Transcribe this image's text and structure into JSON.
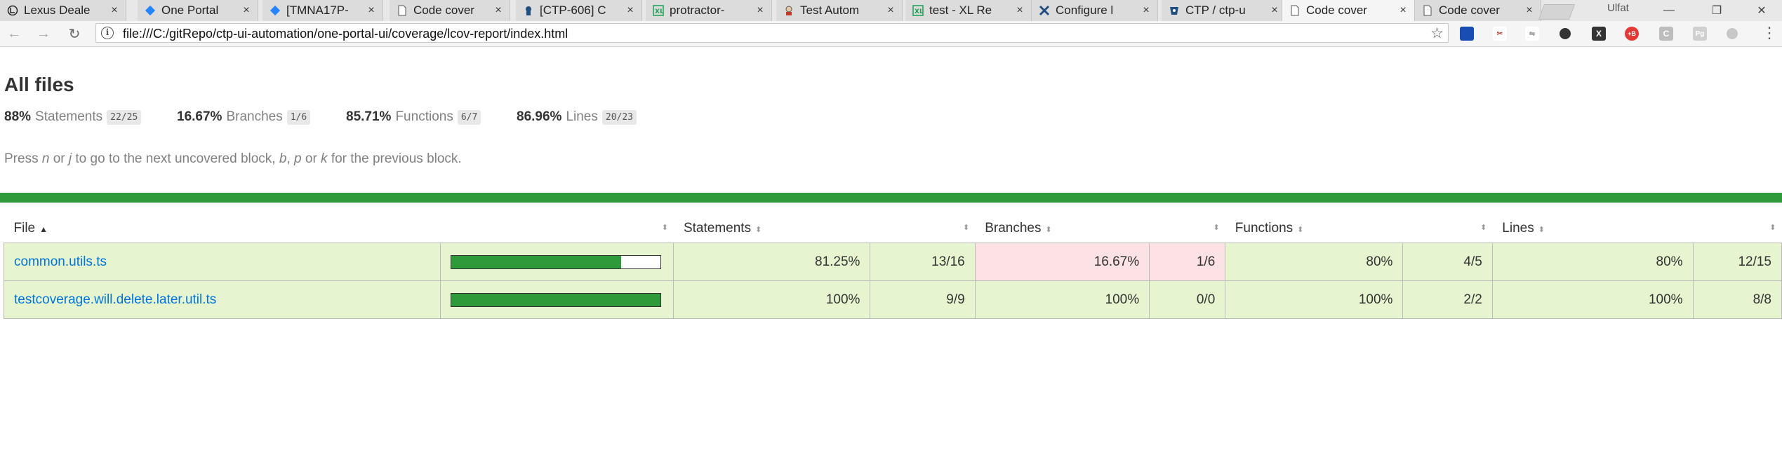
{
  "tabs": [
    {
      "label": "Lexus Deale",
      "icon": "lexus-icon"
    },
    {
      "label": "One Portal",
      "icon": "jira-icon"
    },
    {
      "label": "[TMNA17P-",
      "icon": "jira-icon"
    },
    {
      "label": "Code cover",
      "icon": "page-icon"
    },
    {
      "label": "[CTP-606] C",
      "icon": "jenkins-icon"
    },
    {
      "label": "protractor-",
      "icon": "excel-icon"
    },
    {
      "label": "Test Autom",
      "icon": "jenkins-user-icon"
    },
    {
      "label": "test - XL Re",
      "icon": "excel-icon"
    },
    {
      "label": "Configure l",
      "icon": "xl-release-icon"
    },
    {
      "label": "CTP / ctp-u",
      "icon": "bitbucket-icon"
    },
    {
      "label": "Code cover",
      "icon": "page-icon",
      "active": true
    },
    {
      "label": "Code cover",
      "icon": "page-icon"
    }
  ],
  "tab_close_glyph": "×",
  "user_badge": "Ulfat",
  "window_controls": {
    "minimize": "—",
    "restore": "❐",
    "close": "✕"
  },
  "address_bar": {
    "url": "file:///C:/gitRepo/ctp-ui-automation/one-portal-ui/coverage/lcov-report/index.html",
    "info_glyph": "i",
    "star_glyph": "☆"
  },
  "nav": {
    "back": "←",
    "forward": "→",
    "reload": "↻",
    "menu": "⋮"
  },
  "report": {
    "title": "All files",
    "summary": [
      {
        "pct": "88%",
        "label": "Statements",
        "fraction": "22/25"
      },
      {
        "pct": "16.67%",
        "label": "Branches",
        "fraction": "1/6"
      },
      {
        "pct": "85.71%",
        "label": "Functions",
        "fraction": "6/7"
      },
      {
        "pct": "86.96%",
        "label": "Lines",
        "fraction": "20/23"
      }
    ],
    "help": {
      "t1": "Press ",
      "k1": "n",
      "t2": " or ",
      "k2": "j",
      "t3": " to go to the next uncovered block, ",
      "k3": "b",
      "t4": ", ",
      "k4": "p",
      "t5": " or ",
      "k5": "k",
      "t6": " for the previous block."
    },
    "headers": {
      "file": "File",
      "statements": "Statements",
      "branches": "Branches",
      "functions": "Functions",
      "lines": "Lines"
    },
    "sort_glyph": "⬍",
    "sort_active_glyph": "▲",
    "rows": [
      {
        "file": "common.utils.ts",
        "coverage": 0.8125,
        "statements_pct": "81.25%",
        "statements_frac": "13/16",
        "branches_pct": "16.67%",
        "branches_frac": "1/6",
        "functions_pct": "80%",
        "functions_frac": "4/5",
        "lines_pct": "80%",
        "lines_frac": "12/15"
      },
      {
        "file": "testcoverage.will.delete.later.util.ts",
        "coverage": 1.0,
        "statements_pct": "100%",
        "statements_frac": "9/9",
        "branches_pct": "100%",
        "branches_frac": "0/0",
        "functions_pct": "100%",
        "functions_frac": "2/2",
        "lines_pct": "100%",
        "lines_frac": "8/8"
      }
    ]
  },
  "colors": {
    "high": "#e6f5d0",
    "low": "#fce1e5",
    "bar_fill": "#2f9a3a",
    "status": "#2f9a3a",
    "link": "#0074d9"
  }
}
